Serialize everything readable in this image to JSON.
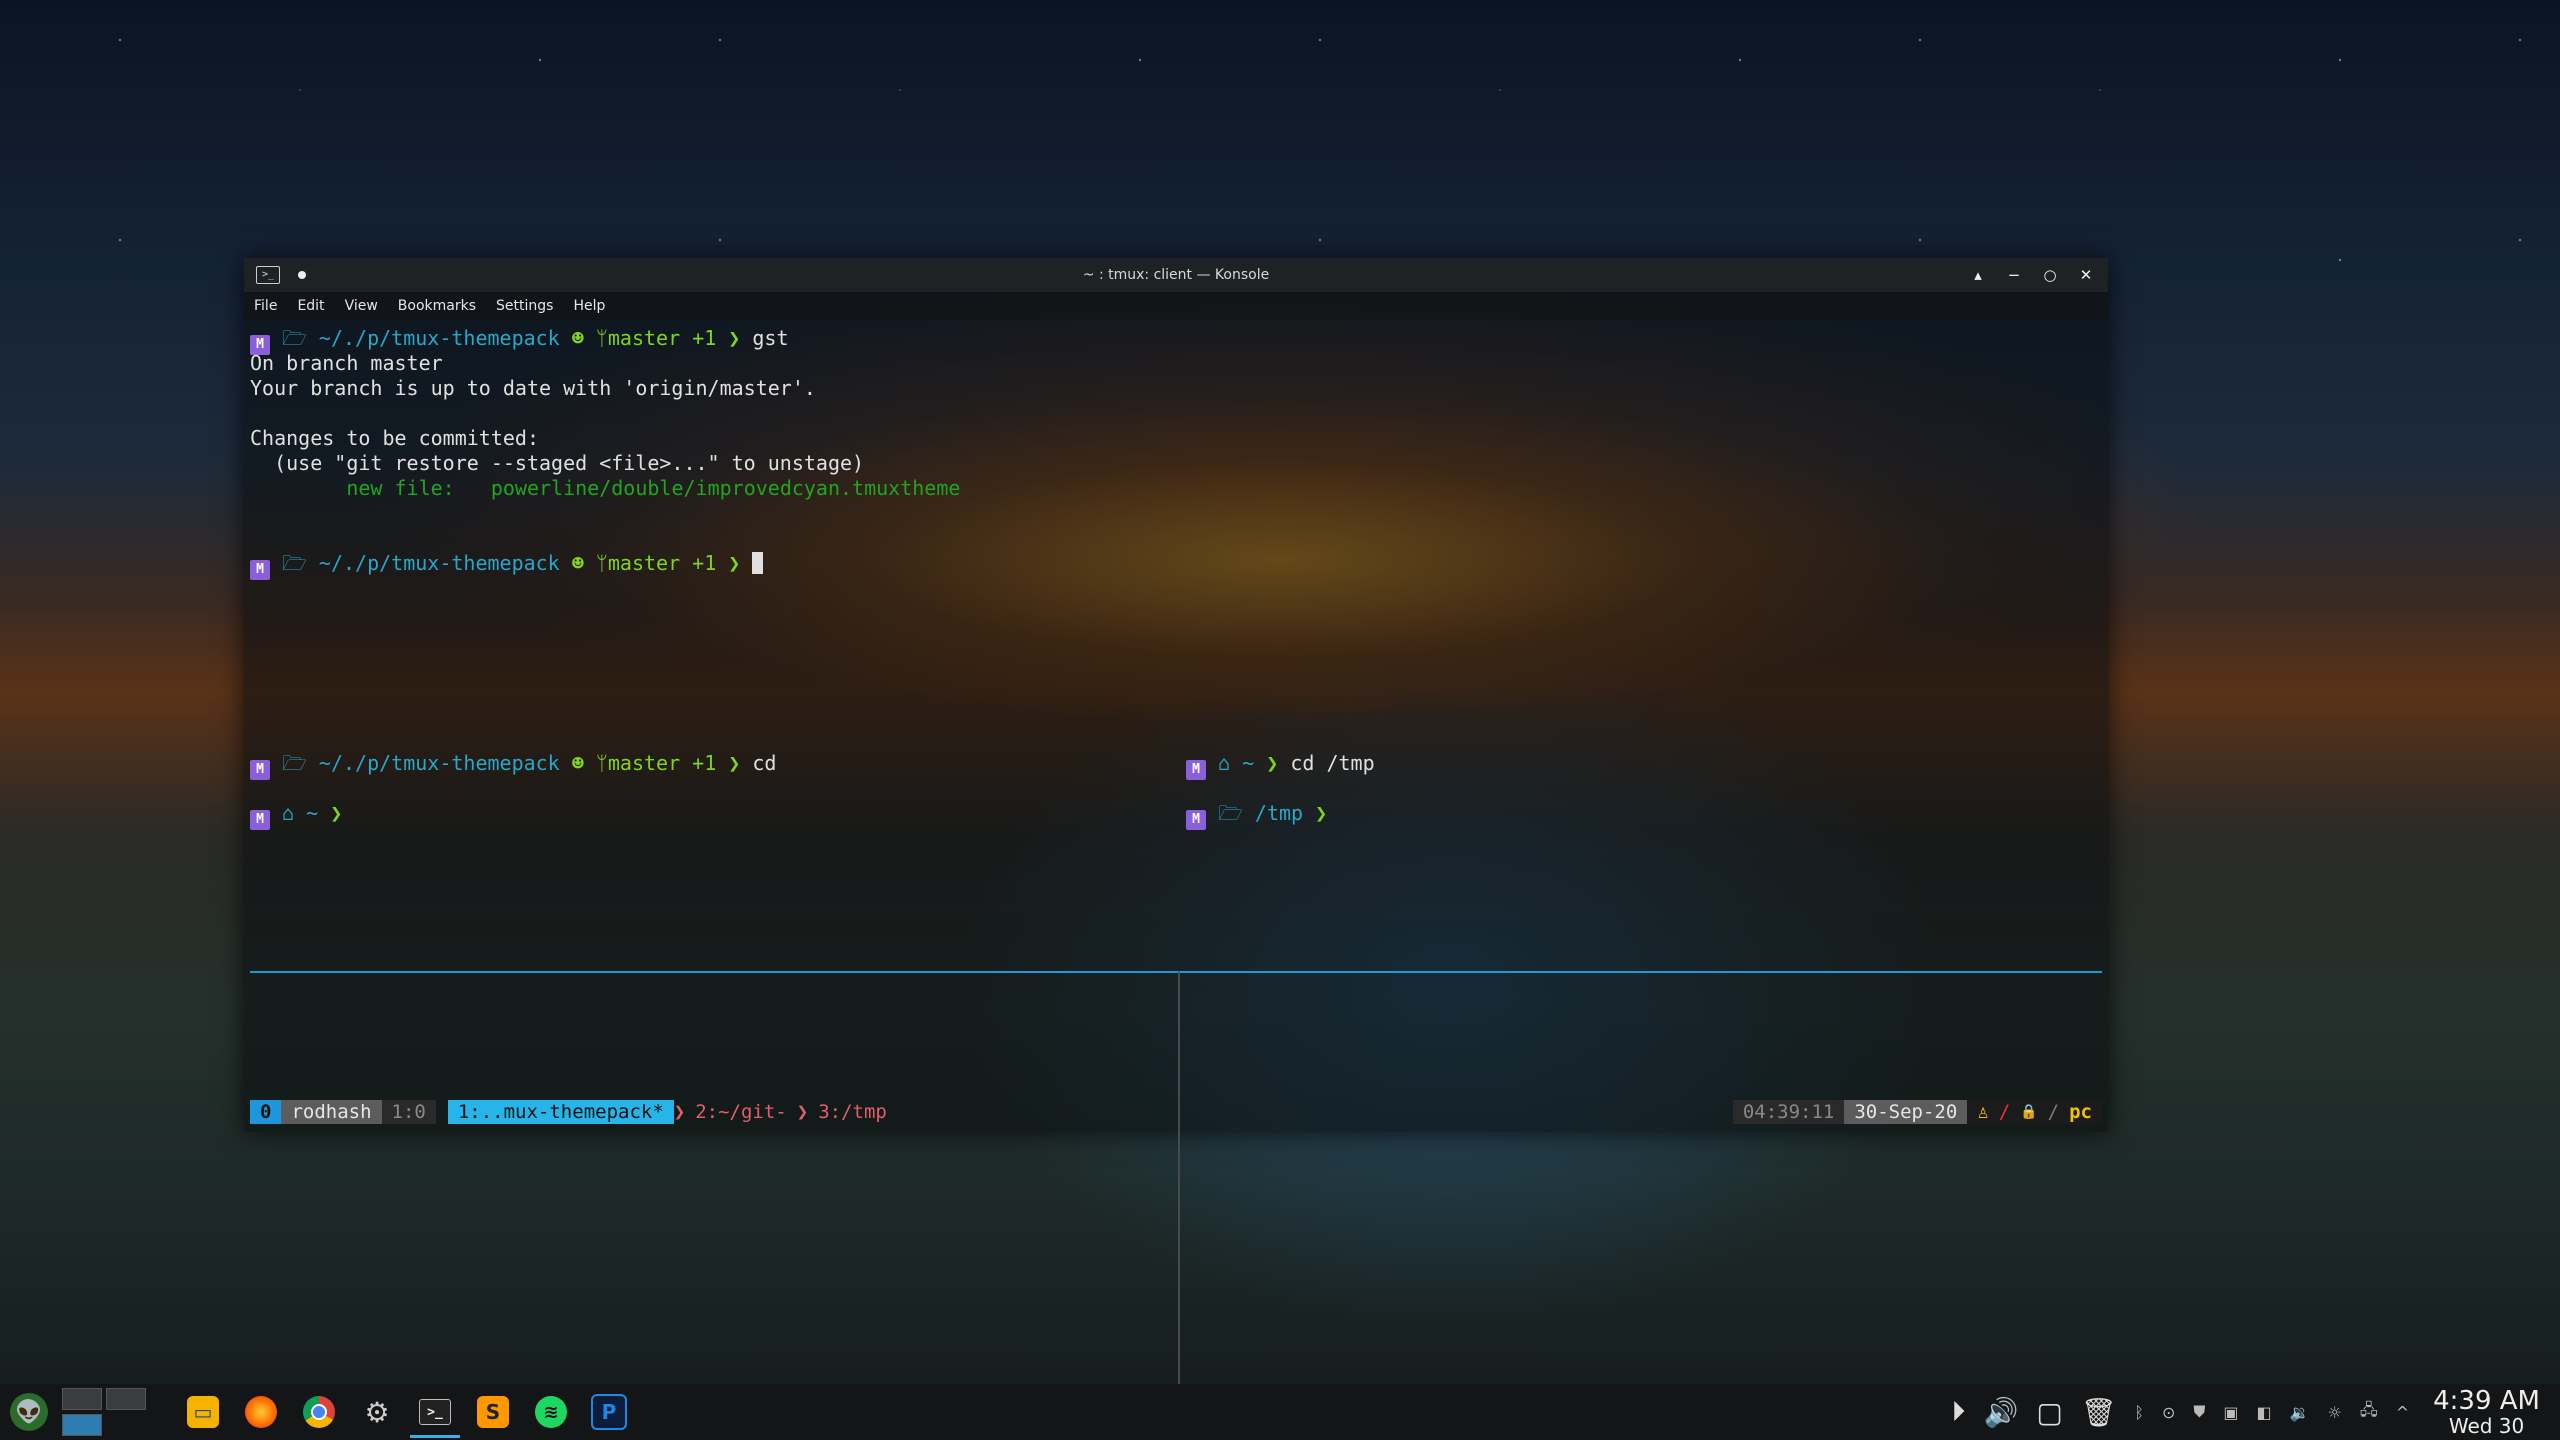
{
  "window": {
    "title": "~ : tmux: client — Konsole",
    "app_icon_glyph": ">_",
    "controls": [
      "▴",
      "−",
      "○",
      "✕"
    ]
  },
  "menu": [
    "File",
    "Edit",
    "View",
    "Bookmarks",
    "Settings",
    "Help"
  ],
  "prompt": {
    "distro_glyph": "▐",
    "folder_glyph": "▬",
    "path": "~/./p/tmux-themepack",
    "git_glyph": "ᛘ",
    "branch": "master +1",
    "arrow": "❯",
    "home_glyph": "⌂",
    "home_path": "~",
    "tmp_path": "/tmp"
  },
  "top_pane": {
    "cmd1": "gst",
    "out1": "On branch master",
    "out2": "Your branch is up to date with 'origin/master'.",
    "out3": "Changes to be committed:",
    "out4": "  (use \"git restore --staged <file>...\" to unstage)",
    "out5_label": "        new file:   ",
    "out5_file": "powerline/double/improvedcyan.tmuxtheme"
  },
  "bottom_left": {
    "cmd1": "cd"
  },
  "bottom_right": {
    "cmd1": "cd /tmp"
  },
  "status": {
    "session": "0",
    "user": "rodhash",
    "pane": "1:0",
    "win_active": "1:..mux-themepack*",
    "win2": "2:~/git-",
    "win3": "3:/tmp",
    "time": "04:39:11",
    "date": "30-Sep-20",
    "host": "pc",
    "lock_glyph": "🔒"
  },
  "taskbar": {
    "clock_time": "4:39 AM",
    "clock_date": "Wed 30",
    "icons": [
      "launcher-icon",
      "pager",
      "files-icon",
      "firefox-icon",
      "chrome-icon",
      "settings-icon",
      "terminal-icon",
      "sublime-icon",
      "spotify-icon",
      "p-app-icon"
    ]
  }
}
